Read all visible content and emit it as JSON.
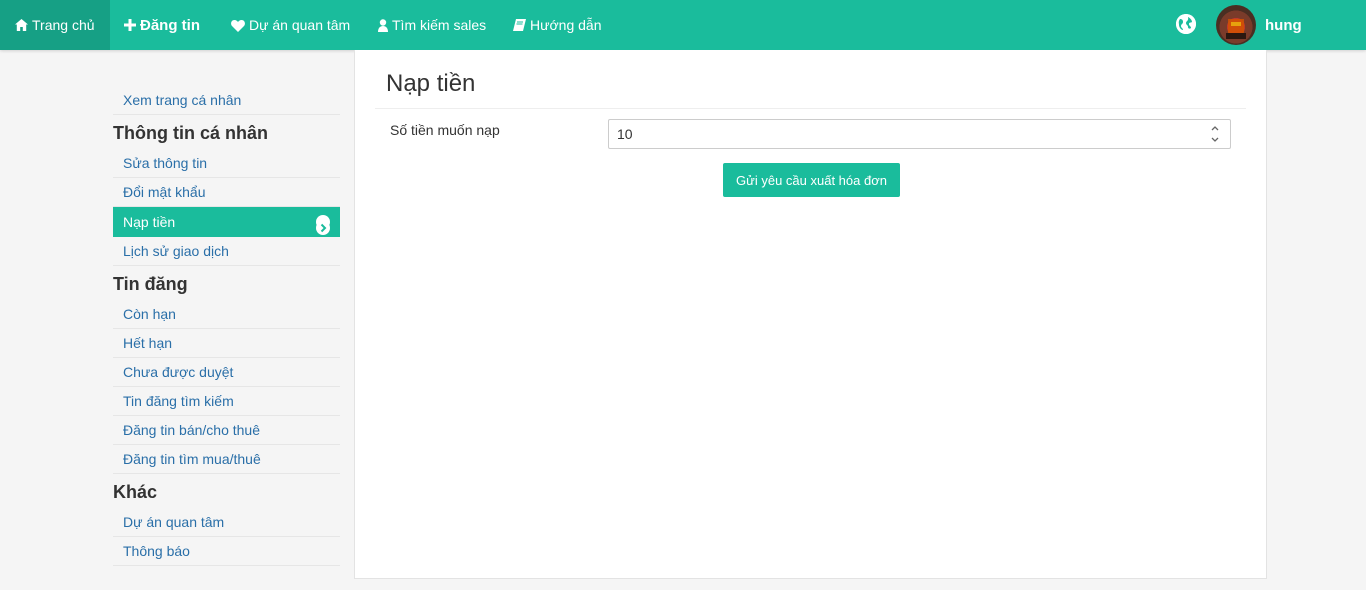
{
  "navbar": {
    "items": [
      {
        "label": "Trang chủ",
        "icon": "home-icon"
      },
      {
        "label": "Đăng tin",
        "icon": "plus-icon"
      },
      {
        "label": "Dự án quan tâm",
        "icon": "heart-icon"
      },
      {
        "label": "Tìm kiếm sales",
        "icon": "user-icon"
      },
      {
        "label": "Hướng dẫn",
        "icon": "book-icon"
      }
    ],
    "globe_icon": "globe-icon",
    "username": "hung",
    "bg_color": "#1abc9c",
    "active_color": "#16a085"
  },
  "sidebar": {
    "profile_link": "Xem trang cá nhân",
    "sections": [
      {
        "title": "Thông tin cá nhân",
        "items": [
          "Sửa thông tin",
          "Đổi mật khẩu",
          "Nạp tiền",
          "Lịch sử giao dịch"
        ]
      },
      {
        "title": "Tin đăng",
        "items": [
          "Còn hạn",
          "Hết hạn",
          "Chưa được duyệt",
          "Tin đăng tìm kiếm",
          "Đăng tin bán/cho thuê",
          "Đăng tin tìm mua/thuê"
        ]
      },
      {
        "title": "Khác",
        "items": [
          "Dự án quan tâm",
          "Thông báo"
        ]
      }
    ],
    "active_item": "Nạp tiền",
    "link_color": "#2a6fa8"
  },
  "main": {
    "title": "Nạp tiền",
    "form": {
      "amount_label": "Số tiền muốn nạp",
      "amount_value": "10",
      "submit_label": "Gửi yêu cầu xuất hóa đơn"
    }
  }
}
